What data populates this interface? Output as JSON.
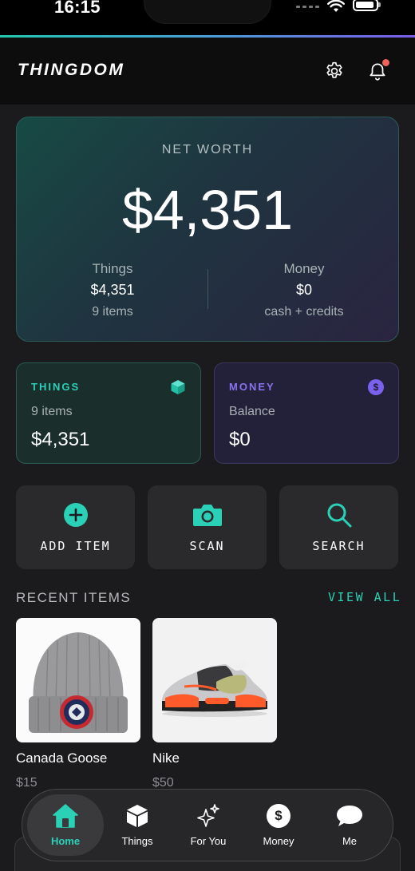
{
  "status_bar": {
    "time": "16:15"
  },
  "header": {
    "brand": "THINGDOM"
  },
  "net_worth": {
    "label": "NET WORTH",
    "value": "$4,351",
    "things": {
      "title": "Things",
      "value": "$4,351",
      "sub": "9 items"
    },
    "money": {
      "title": "Money",
      "value": "$0",
      "sub": "cash + credits"
    }
  },
  "summary": {
    "things": {
      "title": "THINGS",
      "sub": "9 items",
      "value": "$4,351"
    },
    "money": {
      "title": "MONEY",
      "sub": "Balance",
      "value": "$0",
      "badge": "$"
    }
  },
  "actions": {
    "add_item": "ADD ITEM",
    "scan": "SCAN",
    "search": "SEARCH"
  },
  "recent": {
    "title": "RECENT ITEMS",
    "view_all": "VIEW ALL",
    "items": [
      {
        "name": "Canada Goose",
        "price": "$15",
        "icon": "beanie-image"
      },
      {
        "name": "Nike",
        "price": "$50",
        "icon": "sneaker-image"
      }
    ]
  },
  "tabbar": {
    "tabs": [
      {
        "label": "Home",
        "icon": "home-icon",
        "active": true
      },
      {
        "label": "Things",
        "icon": "box-icon"
      },
      {
        "label": "For You",
        "icon": "sparkles-icon"
      },
      {
        "label": "Money",
        "icon": "dollar-coin-icon",
        "glyph": "$"
      },
      {
        "label": "Me",
        "icon": "chat-bubble-icon"
      }
    ]
  },
  "colors": {
    "accent_teal": "#2ad1b7",
    "accent_purple": "#8a72f0",
    "notification": "#f0635b",
    "background": "#1b1b1d"
  }
}
